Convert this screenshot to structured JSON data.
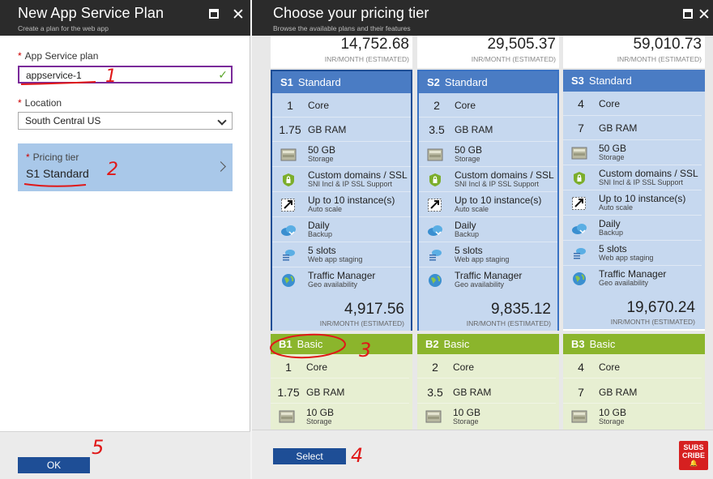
{
  "left_blade": {
    "title": "New App Service Plan",
    "subtitle": "Create a plan for the web app",
    "plan_label": "App Service plan",
    "plan_value": "appservice-1",
    "location_label": "Location",
    "location_value": "South Central US",
    "pricing_label": "Pricing tier",
    "pricing_value": "S1 Standard",
    "ok_label": "OK"
  },
  "right_blade": {
    "title": "Choose your pricing tier",
    "subtitle": "Browse the available plans and their features",
    "select_label": "Select",
    "top_prices": [
      {
        "price": "14,752.68",
        "unit": "INR/MONTH (ESTIMATED)"
      },
      {
        "price": "29,505.37",
        "unit": "INR/MONTH (ESTIMATED)"
      },
      {
        "price": "59,010.73",
        "unit": "INR/MONTH (ESTIMATED)"
      }
    ],
    "standard": [
      {
        "code": "S1",
        "name": "Standard",
        "cores": "1",
        "ram": "1.75",
        "price": "4,917.56"
      },
      {
        "code": "S2",
        "name": "Standard",
        "cores": "2",
        "ram": "3.5",
        "price": "9,835.12"
      },
      {
        "code": "S3",
        "name": "Standard",
        "cores": "4",
        "ram": "7",
        "price": "19,670.24"
      }
    ],
    "basic": [
      {
        "code": "B1",
        "name": "Basic",
        "cores": "1",
        "ram": "1.75"
      },
      {
        "code": "B2",
        "name": "Basic",
        "cores": "2",
        "ram": "3.5"
      },
      {
        "code": "B3",
        "name": "Basic",
        "cores": "4",
        "ram": "7"
      }
    ],
    "features": {
      "core": "Core",
      "ram": "GB RAM",
      "storage": "50 GB",
      "storage_basic": "10 GB",
      "storage_sub": "Storage",
      "domains": "Custom domains / SSL",
      "domains_sub": "SNI Incl & IP SSL Support",
      "scale": "Up to 10 instance(s)",
      "scale_sub": "Auto scale",
      "backup": "Daily",
      "backup_sub": "Backup",
      "slots": "5 slots",
      "slots_sub": "Web app staging",
      "traffic": "Traffic Manager",
      "traffic_sub": "Geo availability",
      "price_unit": "INR/MONTH (ESTIMATED)"
    }
  },
  "annotations": {
    "n1": "1",
    "n2": "2",
    "n3": "3",
    "n4": "4",
    "n5": "5"
  },
  "subscribe_logo": {
    "line1": "SUBS",
    "line2": "CRIBE"
  },
  "colors": {
    "header": "#2b2b2b",
    "standard": "#4a7cc4",
    "basic": "#8bb52c",
    "button": "#1e4e96",
    "annotation": "#e01818"
  }
}
